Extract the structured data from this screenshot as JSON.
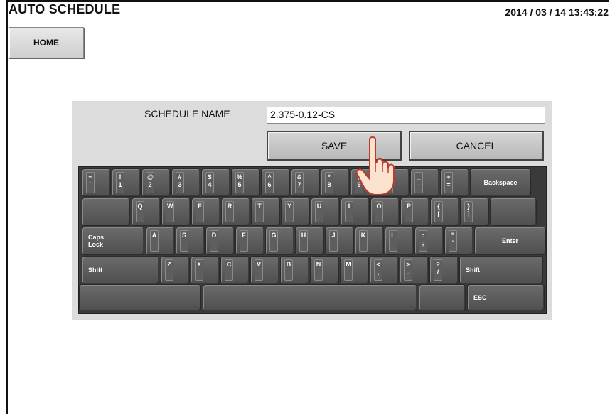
{
  "app": {
    "title": "AUTO SCHEDULE",
    "datetime": "2014 / 03 / 14   13:43:22"
  },
  "nav": {
    "home_label": "HOME"
  },
  "dialog": {
    "name_label": "SCHEDULE NAME",
    "name_value": "2.375-0.12-CS",
    "save_label": "SAVE",
    "cancel_label": "CANCEL"
  },
  "keyboard": {
    "row1": [
      {
        "top": "~",
        "bottom": "`"
      },
      {
        "top": "!",
        "bottom": "1"
      },
      {
        "top": "@",
        "bottom": "2"
      },
      {
        "top": "#",
        "bottom": "3"
      },
      {
        "top": "$",
        "bottom": "4"
      },
      {
        "top": "%",
        "bottom": "5"
      },
      {
        "top": "^",
        "bottom": "6"
      },
      {
        "top": "&",
        "bottom": "7"
      },
      {
        "top": "*",
        "bottom": "8"
      },
      {
        "top": "(",
        "bottom": "9"
      },
      {
        "top": ")",
        "bottom": "0"
      },
      {
        "top": "_",
        "bottom": "-"
      },
      {
        "top": "+",
        "bottom": "="
      }
    ],
    "backspace": "Backspace",
    "row2": [
      {
        "top": "Q",
        "bottom": ""
      },
      {
        "top": "W",
        "bottom": ""
      },
      {
        "top": "E",
        "bottom": ""
      },
      {
        "top": "R",
        "bottom": ""
      },
      {
        "top": "T",
        "bottom": ""
      },
      {
        "top": "Y",
        "bottom": ""
      },
      {
        "top": "U",
        "bottom": ""
      },
      {
        "top": "I",
        "bottom": ""
      },
      {
        "top": "O",
        "bottom": ""
      },
      {
        "top": "P",
        "bottom": ""
      },
      {
        "top": "{",
        "bottom": "["
      },
      {
        "top": "}",
        "bottom": "]"
      }
    ],
    "caps": "Caps\nLock",
    "row3": [
      {
        "top": "A",
        "bottom": ""
      },
      {
        "top": "S",
        "bottom": ""
      },
      {
        "top": "D",
        "bottom": ""
      },
      {
        "top": "F",
        "bottom": ""
      },
      {
        "top": "G",
        "bottom": ""
      },
      {
        "top": "H",
        "bottom": ""
      },
      {
        "top": "J",
        "bottom": ""
      },
      {
        "top": "K",
        "bottom": ""
      },
      {
        "top": "L",
        "bottom": ""
      },
      {
        "top": ":",
        "bottom": ";"
      },
      {
        "top": "\"",
        "bottom": "'"
      }
    ],
    "enter": "Enter",
    "shift": "Shift",
    "row4": [
      {
        "top": "Z",
        "bottom": ""
      },
      {
        "top": "X",
        "bottom": ""
      },
      {
        "top": "C",
        "bottom": ""
      },
      {
        "top": "V",
        "bottom": ""
      },
      {
        "top": "B",
        "bottom": ""
      },
      {
        "top": "N",
        "bottom": ""
      },
      {
        "top": "M",
        "bottom": ""
      },
      {
        "top": "<",
        "bottom": ","
      },
      {
        "top": ">",
        "bottom": "."
      },
      {
        "top": "?",
        "bottom": "/"
      }
    ],
    "esc": "ESC"
  },
  "icons": {
    "pointer": "pointing-hand-icon"
  }
}
